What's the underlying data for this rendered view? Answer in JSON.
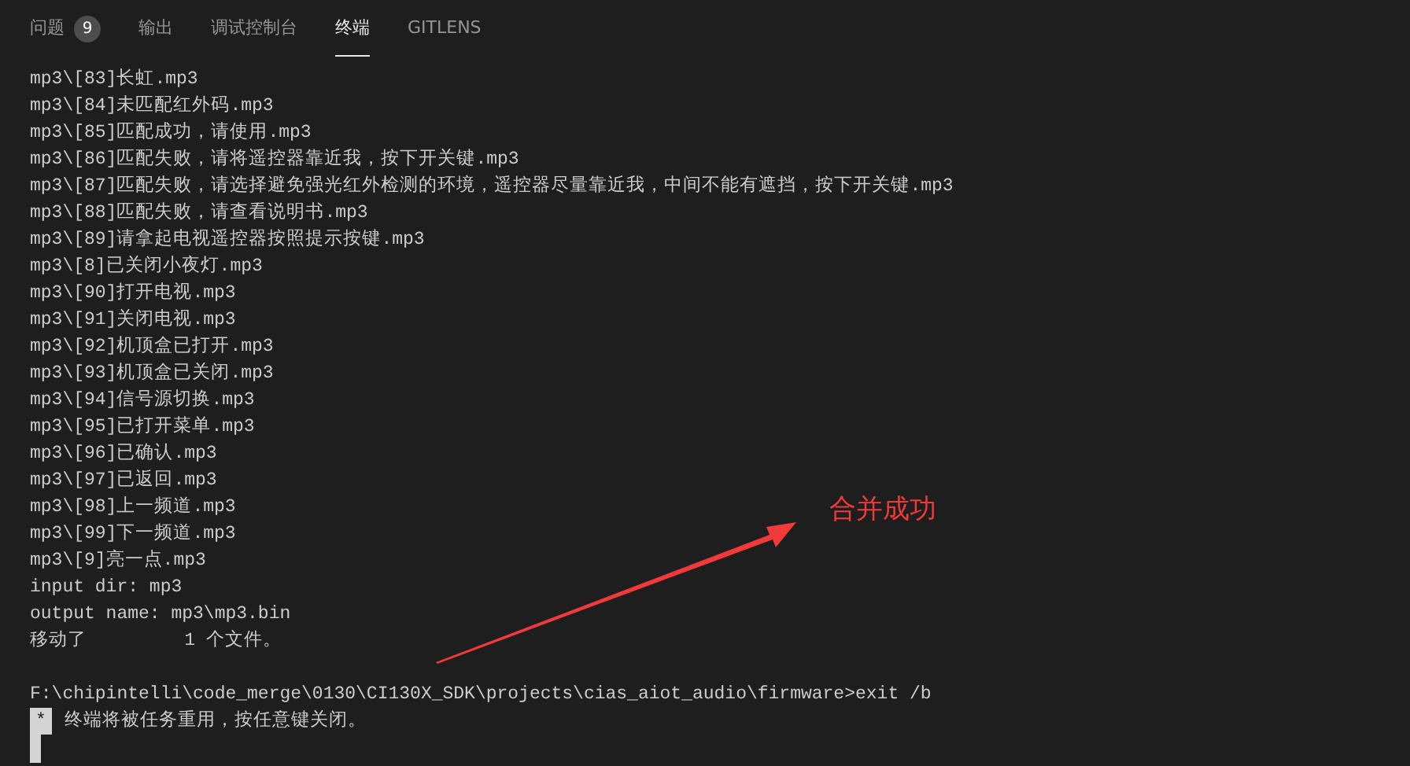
{
  "tabs": [
    {
      "label": "问题",
      "badge": "9",
      "selected": false
    },
    {
      "label": "输出",
      "selected": false
    },
    {
      "label": "调试控制台",
      "selected": false
    },
    {
      "label": "终端",
      "selected": true
    },
    {
      "label": "GITLENS",
      "selected": false
    }
  ],
  "terminal": {
    "lines": [
      "mp3\\[83]长虹.mp3",
      "mp3\\[84]未匹配红外码.mp3",
      "mp3\\[85]匹配成功，请使用.mp3",
      "mp3\\[86]匹配失败，请将遥控器靠近我，按下开关键.mp3",
      "mp3\\[87]匹配失败，请选择避免强光红外检测的环境，遥控器尽量靠近我，中间不能有遮挡，按下开关键.mp3",
      "mp3\\[88]匹配失败，请查看说明书.mp3",
      "mp3\\[89]请拿起电视遥控器按照提示按键.mp3",
      "mp3\\[8]已关闭小夜灯.mp3",
      "mp3\\[90]打开电视.mp3",
      "mp3\\[91]关闭电视.mp3",
      "mp3\\[92]机顶盒已打开.mp3",
      "mp3\\[93]机顶盒已关闭.mp3",
      "mp3\\[94]信号源切换.mp3",
      "mp3\\[95]已打开菜单.mp3",
      "mp3\\[96]已确认.mp3",
      "mp3\\[97]已返回.mp3",
      "mp3\\[98]上一频道.mp3",
      "mp3\\[99]下一频道.mp3",
      "mp3\\[9]亮一点.mp3",
      "input dir: mp3",
      "output name: mp3\\mp3.bin",
      "移动了         1 个文件。"
    ],
    "prompt": "F:\\chipintelli\\code_merge\\0130\\CI130X_SDK\\projects\\cias_aiot_audio\\firmware>exit /b",
    "notice_marker": "*",
    "notice": "终端将被任务重用，按任意键关闭。"
  },
  "annotation": {
    "label": "合并成功"
  }
}
